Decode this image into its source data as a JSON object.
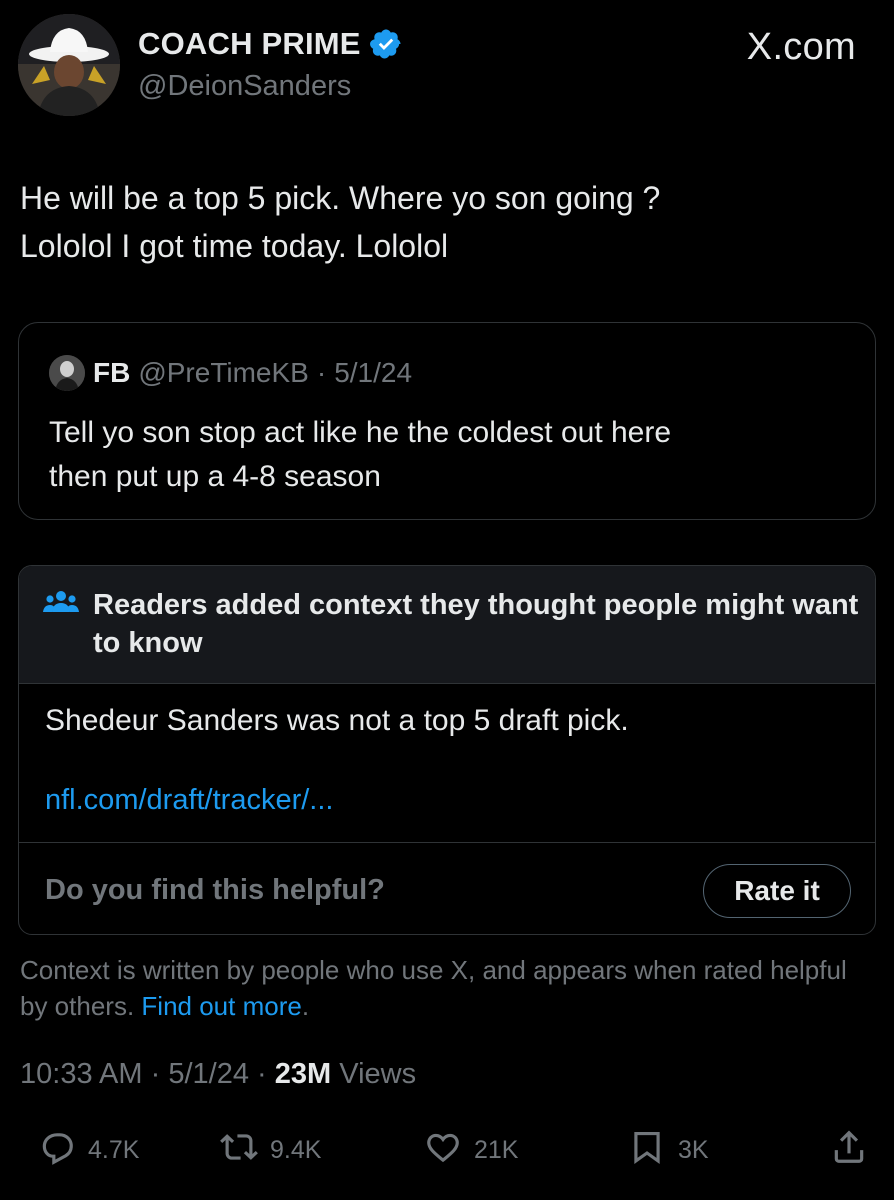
{
  "header": {
    "display_name": "COACH PRIME",
    "handle": "@DeionSanders",
    "brand": "X.com"
  },
  "tweet": {
    "text": "He will be a top 5 pick. Where yo son going ?\nLololol I got time today. Lololol"
  },
  "quote": {
    "name": "FB",
    "handle": "@PreTimeKB",
    "separator": "·",
    "date": "5/1/24",
    "text": "Tell yo son stop act like he the coldest out here\nthen put up a  4-8 season"
  },
  "community_note": {
    "title": "Readers added context they thought people might want to know",
    "body": "Shedeur Sanders was not a top 5 draft pick.",
    "link": "nfl.com/draft/tracker/...",
    "helpful_question": "Do you find this helpful?",
    "rate_button": "Rate it",
    "footer_text": "Context is written by people who use X, and appears when rated helpful by others.",
    "footer_link": "Find out more",
    "footer_end": "."
  },
  "meta": {
    "time": "10:33 AM",
    "separator": "·",
    "date": "5/1/24",
    "views_count": "23M",
    "views_label": "Views"
  },
  "actions": {
    "replies": "4.7K",
    "reposts": "9.4K",
    "likes": "21K",
    "bookmarks": "3K"
  },
  "colors": {
    "background": "#000000",
    "text": "#e7e9ea",
    "secondary": "#71767b",
    "accent": "#1d9bf0",
    "verified": "#1d9bf0"
  },
  "icons": [
    "verified-badge-icon",
    "readers-icon",
    "reply-icon",
    "repost-icon",
    "like-icon",
    "bookmark-icon",
    "share-icon"
  ]
}
